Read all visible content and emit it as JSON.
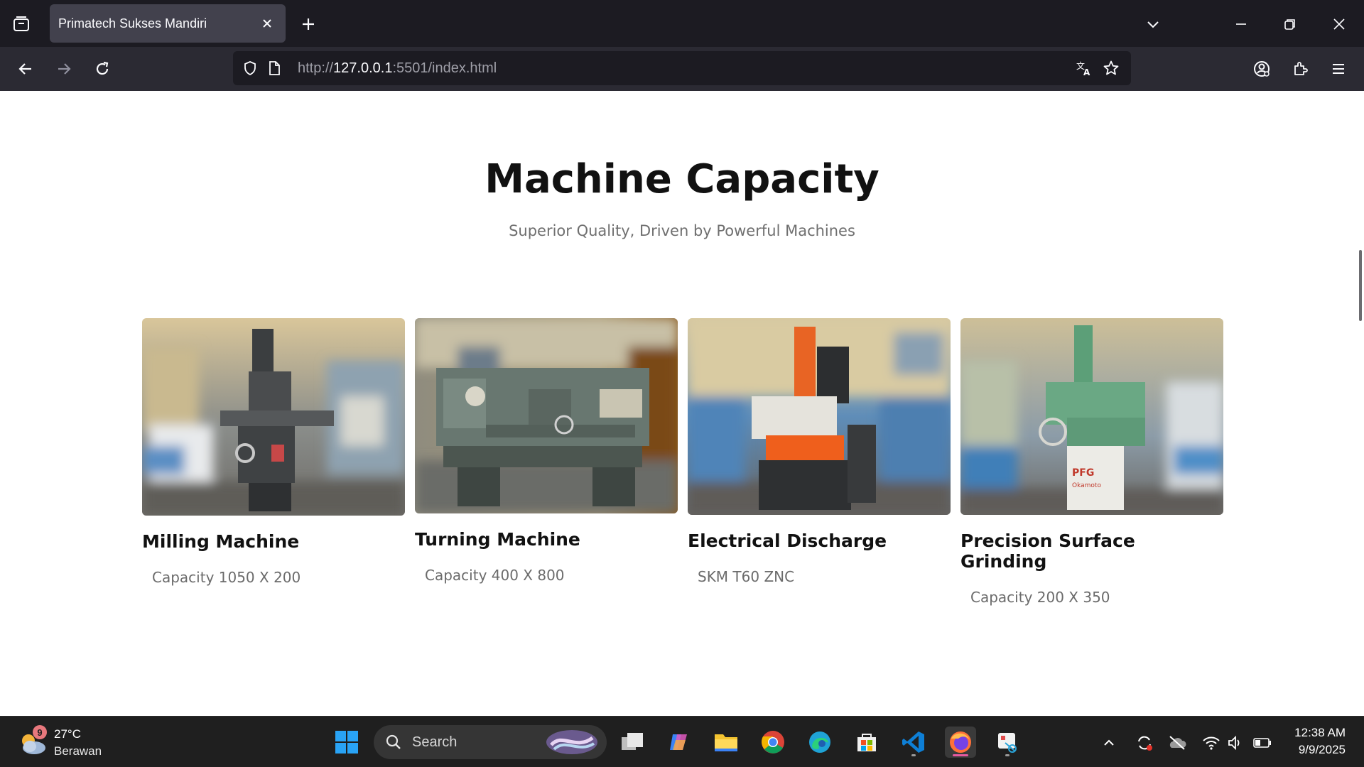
{
  "browser": {
    "tab_title": "Primatech Sukses Mandiri",
    "url_prefix": "http://",
    "url_host": "127.0.0.1",
    "url_rest": ":5501/index.html"
  },
  "page": {
    "title": "Machine Capacity",
    "subtitle": "Superior Quality, Driven by Powerful Machines",
    "cards": [
      {
        "title": "Milling Machine",
        "desc": "Capacity 1050 X 200"
      },
      {
        "title": "Turning Machine",
        "desc": "Capacity 400 X 800"
      },
      {
        "title": "Electrical Discharge",
        "desc": "SKM T60 ZNC"
      },
      {
        "title": "Precision Surface Grinding",
        "desc": "Capacity 200 X 350"
      }
    ]
  },
  "taskbar": {
    "weather_temp": "27°C",
    "weather_desc": "Berawan",
    "weather_badge": "9",
    "search_label": "Search",
    "time": "12:38 AM",
    "date": "9/9/2025"
  }
}
